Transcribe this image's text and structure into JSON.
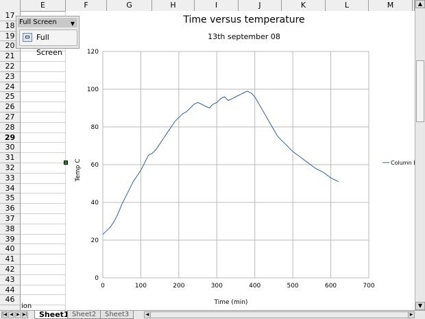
{
  "columns": [
    "E",
    "F",
    "G",
    "H",
    "I",
    "J",
    "K",
    "L",
    "M"
  ],
  "rows": [
    "17",
    "18",
    "19",
    "20",
    "21",
    "22",
    "23",
    "24",
    "25",
    "26",
    "27",
    "28",
    "29",
    "30",
    "31",
    "32",
    "33",
    "34",
    "35",
    "36",
    "37",
    "38",
    "39",
    "40",
    "41",
    "42",
    "43",
    "44",
    "46"
  ],
  "active_row": "29",
  "cell_e46": "ion",
  "fullscreen_toolbar": {
    "title": "Full Screen",
    "button_label": "Full Screen"
  },
  "sheet_tabs": [
    "Sheet1",
    "Sheet2",
    "Sheet3"
  ],
  "active_tab": "Sheet1",
  "chart_data": {
    "type": "line",
    "title": "Time versus temperature",
    "subtitle": "13th september 08",
    "xlabel": "Time (min)",
    "ylabel": "Temp C",
    "xlim": [
      0,
      700
    ],
    "ylim": [
      0,
      120
    ],
    "xticks": [
      0,
      100,
      200,
      300,
      400,
      500,
      600,
      700
    ],
    "yticks": [
      0,
      20,
      40,
      60,
      80,
      100,
      120
    ],
    "grid": true,
    "legend_position": "right",
    "series": [
      {
        "name": "Column B",
        "color": "#2b5f9e",
        "x": [
          0,
          10,
          20,
          30,
          40,
          50,
          60,
          70,
          80,
          90,
          100,
          110,
          120,
          130,
          140,
          150,
          160,
          170,
          180,
          190,
          200,
          210,
          220,
          230,
          240,
          250,
          260,
          270,
          280,
          290,
          300,
          310,
          320,
          330,
          340,
          350,
          360,
          370,
          380,
          390,
          400,
          420,
          440,
          460,
          480,
          500,
          520,
          540,
          560,
          580,
          600,
          620
        ],
        "values": [
          23,
          25,
          27,
          30,
          34,
          39,
          43,
          47,
          51,
          54,
          57,
          61,
          65,
          66,
          68,
          71,
          74,
          77,
          80,
          83,
          85,
          87,
          88,
          90,
          92,
          93,
          92,
          91,
          90,
          92,
          93,
          95,
          96,
          94,
          95,
          96,
          97,
          98,
          99,
          98,
          96,
          89,
          82,
          75,
          71,
          67,
          64,
          61,
          58,
          56,
          53,
          51
        ]
      }
    ]
  }
}
